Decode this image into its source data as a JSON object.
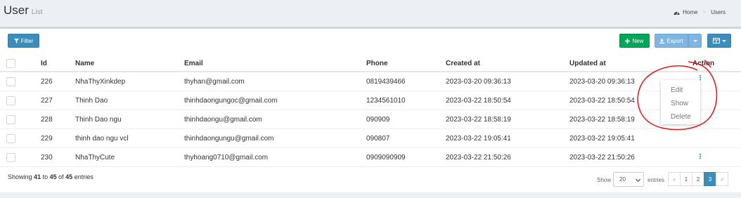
{
  "header": {
    "title": "User",
    "subtitle": "List"
  },
  "breadcrumb": {
    "home": "Home",
    "current": "Users"
  },
  "toolbar": {
    "filter": "Filter",
    "new": "New",
    "export": "Export"
  },
  "table": {
    "columns": {
      "id": "Id",
      "name": "Name",
      "email": "Email",
      "phone": "Phone",
      "created": "Created at",
      "updated": "Updated at",
      "action": "Action"
    },
    "rows": [
      {
        "id": "226",
        "name": "NhaThyXinkdep",
        "email": "thyhan@gmail.com",
        "phone": "0819439466",
        "created": "2023-03-20 09:36:13",
        "updated": "2023-03-20 09:36:13"
      },
      {
        "id": "227",
        "name": "Thinh Dao",
        "email": "thinhdaongungoc@gmail.com",
        "phone": "1234561010",
        "created": "2023-03-22 18:50:54",
        "updated": "2023-03-22 18:50:54"
      },
      {
        "id": "228",
        "name": "Thinh Dao ngu",
        "email": "thinhdaongu@gmail.com",
        "phone": "090909",
        "created": "2023-03-22 18:58:19",
        "updated": "2023-03-22 18:58:19"
      },
      {
        "id": "229",
        "name": "thinh dao ngu vcl",
        "email": "thinhdaongungu@gmail.com",
        "phone": "090807",
        "created": "2023-03-22 19:05:41",
        "updated": "2023-03-22 19:05:41"
      },
      {
        "id": "230",
        "name": "NhaThyCute",
        "email": "thyhoang0710@gmail.com",
        "phone": "0909090909",
        "created": "2023-03-22 21:50:26",
        "updated": "2023-03-22 21:50:26"
      }
    ]
  },
  "action_menu": {
    "edit": "Edit",
    "show": "Show",
    "delete": "Delete"
  },
  "footer": {
    "showing_prefix": "Showing",
    "start": "41",
    "to": "to",
    "end": "45",
    "of": "of",
    "total": "45",
    "entries": "entries",
    "show_label": "Show",
    "page_length": "20",
    "entries_label": "entries",
    "pages": {
      "prev": "«",
      "p1": "1",
      "p2": "2",
      "p3": "3",
      "next": "»"
    }
  },
  "colors": {
    "primary": "#3c8dbc",
    "success": "#00a65a",
    "export": "#7fb5e0",
    "annotation": "#e02020"
  },
  "icons": [
    "filter-icon",
    "plus-icon",
    "download-icon",
    "table-columns-icon",
    "dashboard-icon",
    "kebab-menu-icon"
  ]
}
